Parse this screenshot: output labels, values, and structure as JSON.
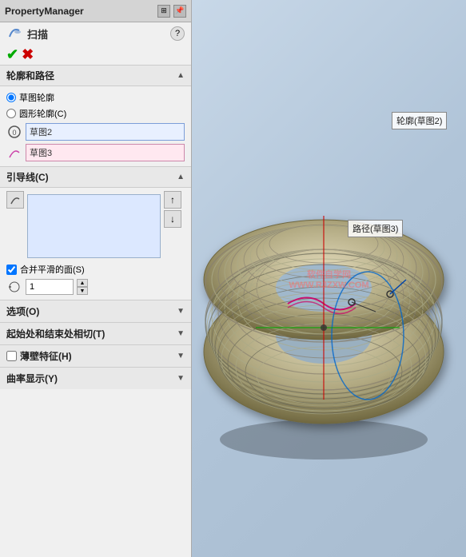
{
  "panel": {
    "title": "PropertyManager",
    "header_icons": [
      "grid",
      "pin"
    ],
    "sweep_title": "扫描",
    "help": "?",
    "ok_label": "✔",
    "cancel_label": "✖",
    "sections": {
      "profile": {
        "title": "轮廓和路径",
        "radio_options": [
          {
            "label": "草图轮廓",
            "checked": true
          },
          {
            "label": "圆形轮廓(C)",
            "checked": false
          }
        ],
        "icon1": "0",
        "field1": "草图2",
        "field1_color": "blue",
        "icon2": "curve",
        "field2": "草图3",
        "field2_color": "pink"
      },
      "guide": {
        "title": "引导线(C)",
        "list_items": [],
        "up_label": "↑",
        "down_label": "↓",
        "checkbox_label": "合并平滑的面(S)",
        "checkbox_checked": true,
        "num_value": "1"
      },
      "options": {
        "title": "选项(O)"
      },
      "tangent": {
        "title": "起始处和结束处相切(T)"
      },
      "thin": {
        "title": "薄壁特征(H)"
      },
      "curvature": {
        "title": "曲率显示(Y)"
      }
    }
  },
  "viewport": {
    "label1": "轮廓(草图2)",
    "label2": "路径(草图3)",
    "watermark_line1": "软件自学网",
    "watermark_line2": "WWW.RJZXW.COM"
  }
}
